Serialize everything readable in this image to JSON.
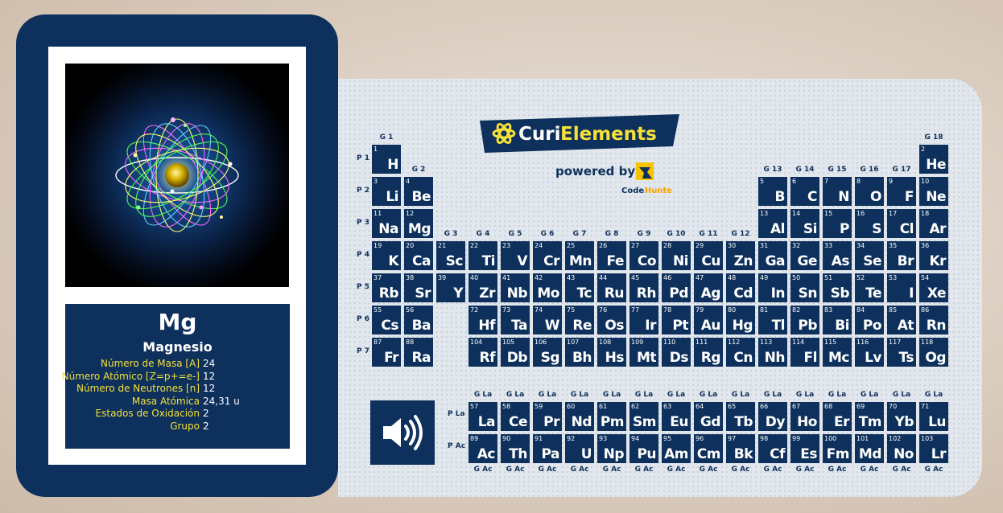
{
  "selected": {
    "symbol": "Mg",
    "name": "Magnesio",
    "properties": [
      {
        "label": "Número de Masa  [A]",
        "value": "24"
      },
      {
        "label": "Número Atómico [Z=p+=e-]",
        "value": "12"
      },
      {
        "label": "Número de Neutrones [n]",
        "value": "12"
      },
      {
        "label": "Masa Atómica",
        "value": "24,31 u"
      },
      {
        "label": "Estados de Oxidación",
        "value": "2"
      },
      {
        "label": "Grupo",
        "value": "2"
      }
    ]
  },
  "branding": {
    "logo_prefix": "Curi",
    "logo_suffix": "Elements",
    "powered_by": "powered by",
    "partner_a": "Code",
    "partner_b": "Hunters"
  },
  "colors": {
    "navy": "#0d305c",
    "yellow": "#f5e03a"
  },
  "group_labels": [
    "G 1",
    "G 2",
    "G 3",
    "G 4",
    "G 5",
    "G 6",
    "G 7",
    "G 8",
    "G 9",
    "G 10",
    "G 11",
    "G 12",
    "G 13",
    "G 14",
    "G 15",
    "G 16",
    "G 17",
    "G 18"
  ],
  "period_labels": [
    "P 1",
    "P 2",
    "P 3",
    "P 4",
    "P 5",
    "P 6",
    "P 7"
  ],
  "lanthanide_row_label": "P La",
  "actinide_row_label": "P Ac",
  "lanthanide_group_label": "G La",
  "actinide_group_label": "G Ac",
  "elements": [
    {
      "n": 1,
      "s": "H",
      "p": 1,
      "g": 1
    },
    {
      "n": 2,
      "s": "He",
      "p": 1,
      "g": 18
    },
    {
      "n": 3,
      "s": "Li",
      "p": 2,
      "g": 1
    },
    {
      "n": 4,
      "s": "Be",
      "p": 2,
      "g": 2
    },
    {
      "n": 5,
      "s": "B",
      "p": 2,
      "g": 13
    },
    {
      "n": 6,
      "s": "C",
      "p": 2,
      "g": 14
    },
    {
      "n": 7,
      "s": "N",
      "p": 2,
      "g": 15
    },
    {
      "n": 8,
      "s": "O",
      "p": 2,
      "g": 16
    },
    {
      "n": 9,
      "s": "F",
      "p": 2,
      "g": 17
    },
    {
      "n": 10,
      "s": "Ne",
      "p": 2,
      "g": 18
    },
    {
      "n": 11,
      "s": "Na",
      "p": 3,
      "g": 1
    },
    {
      "n": 12,
      "s": "Mg",
      "p": 3,
      "g": 2
    },
    {
      "n": 13,
      "s": "Al",
      "p": 3,
      "g": 13
    },
    {
      "n": 14,
      "s": "Si",
      "p": 3,
      "g": 14
    },
    {
      "n": 15,
      "s": "P",
      "p": 3,
      "g": 15
    },
    {
      "n": 16,
      "s": "S",
      "p": 3,
      "g": 16
    },
    {
      "n": 17,
      "s": "Cl",
      "p": 3,
      "g": 17
    },
    {
      "n": 18,
      "s": "Ar",
      "p": 3,
      "g": 18
    },
    {
      "n": 19,
      "s": "K",
      "p": 4,
      "g": 1
    },
    {
      "n": 20,
      "s": "Ca",
      "p": 4,
      "g": 2
    },
    {
      "n": 21,
      "s": "Sc",
      "p": 4,
      "g": 3
    },
    {
      "n": 22,
      "s": "Ti",
      "p": 4,
      "g": 4
    },
    {
      "n": 23,
      "s": "V",
      "p": 4,
      "g": 5
    },
    {
      "n": 24,
      "s": "Cr",
      "p": 4,
      "g": 6
    },
    {
      "n": 25,
      "s": "Mn",
      "p": 4,
      "g": 7
    },
    {
      "n": 26,
      "s": "Fe",
      "p": 4,
      "g": 8
    },
    {
      "n": 27,
      "s": "Co",
      "p": 4,
      "g": 9
    },
    {
      "n": 28,
      "s": "Ni",
      "p": 4,
      "g": 10
    },
    {
      "n": 29,
      "s": "Cu",
      "p": 4,
      "g": 11
    },
    {
      "n": 30,
      "s": "Zn",
      "p": 4,
      "g": 12
    },
    {
      "n": 31,
      "s": "Ga",
      "p": 4,
      "g": 13
    },
    {
      "n": 32,
      "s": "Ge",
      "p": 4,
      "g": 14
    },
    {
      "n": 33,
      "s": "As",
      "p": 4,
      "g": 15
    },
    {
      "n": 34,
      "s": "Se",
      "p": 4,
      "g": 16
    },
    {
      "n": 35,
      "s": "Br",
      "p": 4,
      "g": 17
    },
    {
      "n": 36,
      "s": "Kr",
      "p": 4,
      "g": 18
    },
    {
      "n": 37,
      "s": "Rb",
      "p": 5,
      "g": 1
    },
    {
      "n": 38,
      "s": "Sr",
      "p": 5,
      "g": 2
    },
    {
      "n": 39,
      "s": "Y",
      "p": 5,
      "g": 3
    },
    {
      "n": 40,
      "s": "Zr",
      "p": 5,
      "g": 4
    },
    {
      "n": 41,
      "s": "Nb",
      "p": 5,
      "g": 5
    },
    {
      "n": 42,
      "s": "Mo",
      "p": 5,
      "g": 6
    },
    {
      "n": 43,
      "s": "Tc",
      "p": 5,
      "g": 7
    },
    {
      "n": 44,
      "s": "Ru",
      "p": 5,
      "g": 8
    },
    {
      "n": 45,
      "s": "Rh",
      "p": 5,
      "g": 9
    },
    {
      "n": 46,
      "s": "Pd",
      "p": 5,
      "g": 10
    },
    {
      "n": 47,
      "s": "Ag",
      "p": 5,
      "g": 11
    },
    {
      "n": 48,
      "s": "Cd",
      "p": 5,
      "g": 12
    },
    {
      "n": 49,
      "s": "In",
      "p": 5,
      "g": 13
    },
    {
      "n": 50,
      "s": "Sn",
      "p": 5,
      "g": 14
    },
    {
      "n": 51,
      "s": "Sb",
      "p": 5,
      "g": 15
    },
    {
      "n": 52,
      "s": "Te",
      "p": 5,
      "g": 16
    },
    {
      "n": 53,
      "s": "I",
      "p": 5,
      "g": 17
    },
    {
      "n": 54,
      "s": "Xe",
      "p": 5,
      "g": 18
    },
    {
      "n": 55,
      "s": "Cs",
      "p": 6,
      "g": 1
    },
    {
      "n": 56,
      "s": "Ba",
      "p": 6,
      "g": 2
    },
    {
      "n": 72,
      "s": "Hf",
      "p": 6,
      "g": 4
    },
    {
      "n": 73,
      "s": "Ta",
      "p": 6,
      "g": 5
    },
    {
      "n": 74,
      "s": "W",
      "p": 6,
      "g": 6
    },
    {
      "n": 75,
      "s": "Re",
      "p": 6,
      "g": 7
    },
    {
      "n": 76,
      "s": "Os",
      "p": 6,
      "g": 8
    },
    {
      "n": 77,
      "s": "Ir",
      "p": 6,
      "g": 9
    },
    {
      "n": 78,
      "s": "Pt",
      "p": 6,
      "g": 10
    },
    {
      "n": 79,
      "s": "Au",
      "p": 6,
      "g": 11
    },
    {
      "n": 80,
      "s": "Hg",
      "p": 6,
      "g": 12
    },
    {
      "n": 81,
      "s": "Tl",
      "p": 6,
      "g": 13
    },
    {
      "n": 82,
      "s": "Pb",
      "p": 6,
      "g": 14
    },
    {
      "n": 83,
      "s": "Bi",
      "p": 6,
      "g": 15
    },
    {
      "n": 84,
      "s": "Po",
      "p": 6,
      "g": 16
    },
    {
      "n": 85,
      "s": "At",
      "p": 6,
      "g": 17
    },
    {
      "n": 86,
      "s": "Rn",
      "p": 6,
      "g": 18
    },
    {
      "n": 87,
      "s": "Fr",
      "p": 7,
      "g": 1
    },
    {
      "n": 88,
      "s": "Ra",
      "p": 7,
      "g": 2
    },
    {
      "n": 104,
      "s": "Rf",
      "p": 7,
      "g": 4
    },
    {
      "n": 105,
      "s": "Db",
      "p": 7,
      "g": 5
    },
    {
      "n": 106,
      "s": "Sg",
      "p": 7,
      "g": 6
    },
    {
      "n": 107,
      "s": "Bh",
      "p": 7,
      "g": 7
    },
    {
      "n": 108,
      "s": "Hs",
      "p": 7,
      "g": 8
    },
    {
      "n": 109,
      "s": "Mt",
      "p": 7,
      "g": 9
    },
    {
      "n": 110,
      "s": "Ds",
      "p": 7,
      "g": 10
    },
    {
      "n": 111,
      "s": "Rg",
      "p": 7,
      "g": 11
    },
    {
      "n": 112,
      "s": "Cn",
      "p": 7,
      "g": 12
    },
    {
      "n": 113,
      "s": "Nh",
      "p": 7,
      "g": 13
    },
    {
      "n": 114,
      "s": "Fl",
      "p": 7,
      "g": 14
    },
    {
      "n": 115,
      "s": "Mc",
      "p": 7,
      "g": 15
    },
    {
      "n": 116,
      "s": "Lv",
      "p": 7,
      "g": 16
    },
    {
      "n": 117,
      "s": "Ts",
      "p": 7,
      "g": 17
    },
    {
      "n": 118,
      "s": "Og",
      "p": 7,
      "g": 18
    }
  ],
  "lanthanides": [
    {
      "n": 57,
      "s": "La"
    },
    {
      "n": 58,
      "s": "Ce"
    },
    {
      "n": 59,
      "s": "Pr"
    },
    {
      "n": 60,
      "s": "Nd"
    },
    {
      "n": 61,
      "s": "Pm"
    },
    {
      "n": 62,
      "s": "Sm"
    },
    {
      "n": 63,
      "s": "Eu"
    },
    {
      "n": 64,
      "s": "Gd"
    },
    {
      "n": 65,
      "s": "Tb"
    },
    {
      "n": 66,
      "s": "Dy"
    },
    {
      "n": 67,
      "s": "Ho"
    },
    {
      "n": 68,
      "s": "Er"
    },
    {
      "n": 69,
      "s": "Tm"
    },
    {
      "n": 70,
      "s": "Yb"
    },
    {
      "n": 71,
      "s": "Lu"
    }
  ],
  "actinides": [
    {
      "n": 89,
      "s": "Ac"
    },
    {
      "n": 90,
      "s": "Th"
    },
    {
      "n": 91,
      "s": "Pa"
    },
    {
      "n": 92,
      "s": "U"
    },
    {
      "n": 93,
      "s": "Np"
    },
    {
      "n": 94,
      "s": "Pu"
    },
    {
      "n": 95,
      "s": "Am"
    },
    {
      "n": 96,
      "s": "Cm"
    },
    {
      "n": 97,
      "s": "Bk"
    },
    {
      "n": 98,
      "s": "Cf"
    },
    {
      "n": 99,
      "s": "Es"
    },
    {
      "n": 100,
      "s": "Fm"
    },
    {
      "n": 101,
      "s": "Md"
    },
    {
      "n": 102,
      "s": "No"
    },
    {
      "n": 103,
      "s": "Lr"
    }
  ]
}
